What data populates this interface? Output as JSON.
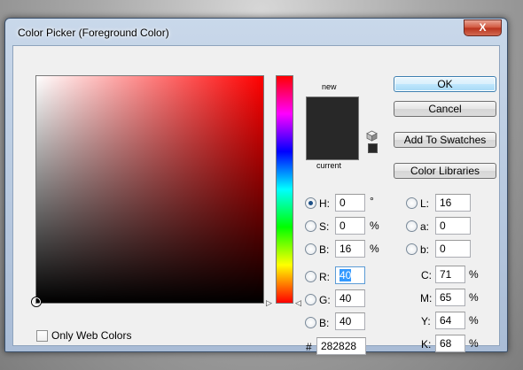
{
  "dialog": {
    "title": "Color Picker (Foreground Color)",
    "close_label": "X"
  },
  "picker": {
    "hue_deg": 0,
    "saturation_pct": 0,
    "brightness_pct": 16,
    "current_color": "#282828",
    "new_color": "#282828"
  },
  "swatches": {
    "new_label": "new",
    "current_label": "current"
  },
  "buttons": {
    "ok": "OK",
    "cancel": "Cancel",
    "add_to_swatches": "Add To Swatches",
    "color_libraries": "Color Libraries"
  },
  "hsb": {
    "h_label": "H:",
    "h_value": "0",
    "h_unit": "°",
    "s_label": "S:",
    "s_value": "0",
    "s_unit": "%",
    "b_label": "B:",
    "b_value": "16",
    "b_unit": "%"
  },
  "rgb": {
    "r_label": "R:",
    "r_value": "40",
    "g_label": "G:",
    "g_value": "40",
    "b_label": "B:",
    "b_value": "40"
  },
  "hex": {
    "label": "#",
    "value": "282828"
  },
  "lab": {
    "l_label": "L:",
    "l_value": "16",
    "a_label": "a:",
    "a_value": "0",
    "b_label": "b:",
    "b_value": "0"
  },
  "cmyk": {
    "c_label": "C:",
    "c_value": "71",
    "c_unit": "%",
    "m_label": "M:",
    "m_value": "65",
    "m_unit": "%",
    "y_label": "Y:",
    "y_value": "64",
    "y_unit": "%",
    "k_label": "K:",
    "k_value": "68",
    "k_unit": "%"
  },
  "options": {
    "web_colors_label": "Only Web Colors",
    "web_colors_checked": false
  },
  "icons": {
    "cube": "gamut-cube-icon",
    "close": "close-icon"
  }
}
